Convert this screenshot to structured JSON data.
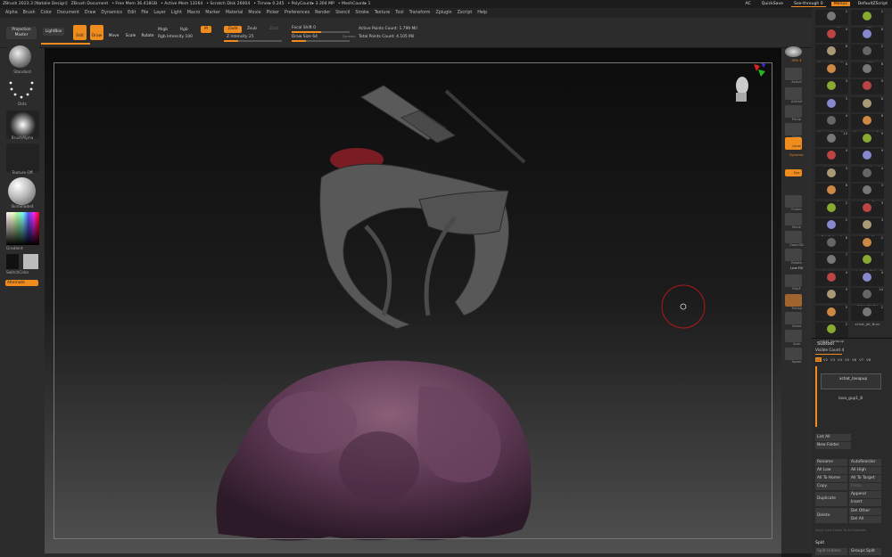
{
  "titlebar": {
    "app": "ZBrush 2023.3 [Natalie Design]",
    "doc": "ZBrush Document",
    "free_mem": "• Free Mem 36.418GB",
    "active_mem": "• Active Mem 13164",
    "scratch": "• Scratch Disk 26004",
    "timer": "• Timer▸ 0.245",
    "polycount": "• PolyCount▸ 3.304 MP",
    "meshcount": "• MeshCount▸ 1",
    "ac": "AC",
    "quicksave": "QuickSave",
    "seethrough": "See-through 0",
    "menus": "Menus",
    "script": "DefaultZScript"
  },
  "menus": [
    "Alpha",
    "Brush",
    "Color",
    "Document",
    "Draw",
    "Dynamics",
    "Edit",
    "File",
    "Layer",
    "Light",
    "Macro",
    "Marker",
    "Material",
    "Movie",
    "Picker",
    "Preferences",
    "Render",
    "Stencil",
    "Stroke",
    "Texture",
    "Tool",
    "Transform",
    "Zplugin",
    "Zscript",
    "Help"
  ],
  "toolbar": {
    "projection_master": "Projection Master",
    "lightbox": "LightBox",
    "edit": "Edit",
    "draw": "Draw",
    "move": "Move",
    "scale": "Scale",
    "rotate": "Rotate",
    "mrgb": "Mrgb",
    "rgb": "Rgb",
    "m": "M",
    "rgb_intensity": "Rgb Intensity 100",
    "zadd": "Zadd",
    "zsub": "Zsub",
    "zcut": "Zcut",
    "z_intensity": "Z Intensity 25",
    "focal_shift": "Focal Shift 0",
    "draw_size": "Draw Size 64",
    "dynamic": "Dynamic",
    "active_points": "Active Points Count: 1.799 Mil",
    "total_points": "Total Points Count: 4.105 Mil"
  },
  "leftpanel": {
    "brush": "Standard",
    "stroke": "Dots",
    "alpha": "BrushAlpha",
    "texture": "Texture Off",
    "material": "SkinShade4",
    "gradient": "Gradient",
    "switch_color": "SwitchColor",
    "alternate": "Alternate"
  },
  "rightbar": [
    "SPix 3",
    "Actual",
    "AAHalf",
    "Persp",
    "Floor",
    "Local",
    "Dynamic",
    "Xyz",
    "Frame",
    "Move",
    "Zoom3D",
    "Rotate",
    "Line Fill",
    "PolyF",
    "Transp",
    "Ghost",
    "Solo",
    "Xpose"
  ],
  "tools": [
    {
      "label": "creature02",
      "count": "2"
    },
    {
      "label": "creature02_merc",
      "count": "2"
    },
    {
      "label": "fox_01_v14",
      "count": "4"
    },
    {
      "label": "xchat_command",
      "count": "8"
    },
    {
      "label": "FemaleYoungTw",
      "count": "8"
    },
    {
      "label": "wall19",
      "count": "2"
    },
    {
      "label": "xchat_command",
      "count": "8"
    },
    {
      "label": "xchat_command",
      "count": "8"
    },
    {
      "label": "xchat_command",
      "count": "3"
    },
    {
      "label": "xchat_command",
      "count": "9"
    },
    {
      "label": "FemaleYoungTw",
      "count": "3"
    },
    {
      "label": "FemaleYoungTw",
      "count": "8"
    },
    {
      "label": "FemaleYoungTw",
      "count": "4"
    },
    {
      "label": "FemaleYoungTw",
      "count": "8"
    },
    {
      "label": "xchat_crab",
      "count": "10"
    },
    {
      "label": "xchat_deadspace",
      "count": "9"
    },
    {
      "label": "xchat_doom",
      "count": "4"
    },
    {
      "label": "creature_base9",
      "count": "9"
    },
    {
      "label": "xchat_dragonn",
      "count": "3"
    },
    {
      "label": "xchat_dragonxx",
      "count": "4"
    },
    {
      "label": "dragon2",
      "count": "8"
    },
    {
      "label": "dragon2",
      "count": "3"
    },
    {
      "label": "xchat_dragonm",
      "count": "2"
    },
    {
      "label": "xchat_dragon_xxx",
      "count": "3"
    },
    {
      "label": "PolySphere1",
      "count": "2"
    },
    {
      "label": "xchat_elite",
      "count": "3"
    },
    {
      "label": "Merged_Fishmon",
      "count": "8"
    },
    {
      "label": "xchat_fishman",
      "count": "2"
    },
    {
      "label": "xchat_hippos",
      "count": "7"
    },
    {
      "label": "xchat_hk_Elder_P",
      "count": "7"
    },
    {
      "label": "xchat_hk_floater",
      "count": "4"
    },
    {
      "label": "xchat_hk_yellow",
      "count": "4"
    },
    {
      "label": "xchat_horned_co",
      "count": "9"
    },
    {
      "label": "JRIM_YOUTH",
      "count": "14"
    },
    {
      "label": "JET_PACK_CAT",
      "count": "5"
    },
    {
      "label": "xchat_Jet_Burn",
      "count": "2"
    },
    {
      "label": "xchat_lavapup",
      "count": "2"
    }
  ],
  "subtool": {
    "title": "Subtool",
    "visible_count": "Visible Count 4",
    "tabs": [
      "V1",
      "V2",
      "V3",
      "V4",
      "V5",
      "V6",
      "V7",
      "V8"
    ],
    "items": [
      "xchat_lavapup",
      "lava_gup1_8"
    ],
    "list_all": "List All",
    "new_folder": "New Folder",
    "rename": "Rename",
    "autoreorder": "AutoReorder",
    "all_low": "All Low",
    "all_high": "All High",
    "all_to_home": "All To Home",
    "all_to_target": "All To Target",
    "copy": "Copy",
    "paste": "Paste",
    "duplicate": "Duplicate",
    "append": "Append",
    "insert": "Insert",
    "delete": "Delete",
    "del_other": "Del Other",
    "del_all": "Del All",
    "apply_last": "Apply Last Action To All Subtools",
    "split": "Split",
    "split_hidden": "Split Hidden",
    "groups_split": "Groups Split"
  },
  "colors": {
    "accent": "#f08c1e",
    "panel": "#2c2c2c",
    "viewport_top": "#0c0c0c",
    "viewport_bottom": "#505050"
  }
}
